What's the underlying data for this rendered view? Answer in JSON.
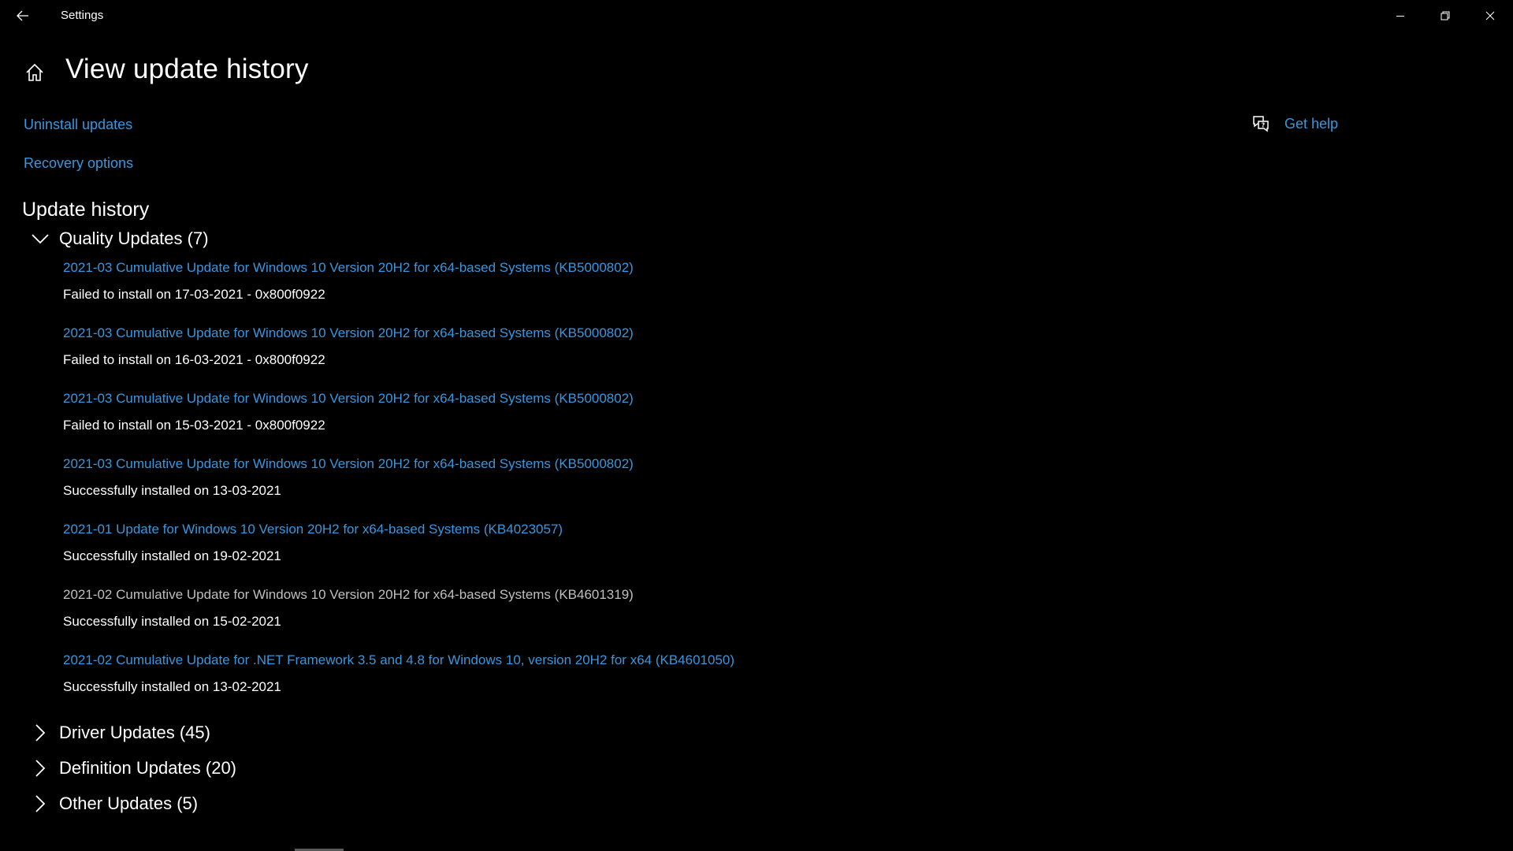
{
  "window": {
    "app_title": "Settings"
  },
  "header": {
    "page_title": "View update history"
  },
  "links": {
    "uninstall": "Uninstall updates",
    "recovery": "Recovery options",
    "get_help": "Get help"
  },
  "section_title": "Update history",
  "groups": {
    "quality": {
      "label": "Quality Updates (7)",
      "expanded": true
    },
    "driver": {
      "label": "Driver Updates (45)",
      "expanded": false
    },
    "definition": {
      "label": "Definition Updates (20)",
      "expanded": false
    },
    "other": {
      "label": "Other Updates (5)",
      "expanded": false
    }
  },
  "quality_updates": [
    {
      "title": "2021-03 Cumulative Update for Windows 10 Version 20H2 for x64-based Systems (KB5000802)",
      "status": "Failed to install on 17-03-2021 - 0x800f0922",
      "is_link": true
    },
    {
      "title": "2021-03 Cumulative Update for Windows 10 Version 20H2 for x64-based Systems (KB5000802)",
      "status": "Failed to install on 16-03-2021 - 0x800f0922",
      "is_link": true
    },
    {
      "title": "2021-03 Cumulative Update for Windows 10 Version 20H2 for x64-based Systems (KB5000802)",
      "status": "Failed to install on 15-03-2021 - 0x800f0922",
      "is_link": true
    },
    {
      "title": "2021-03 Cumulative Update for Windows 10 Version 20H2 for x64-based Systems (KB5000802)",
      "status": "Successfully installed on 13-03-2021",
      "is_link": true
    },
    {
      "title": "2021-01 Update for Windows 10 Version 20H2 for x64-based Systems (KB4023057)",
      "status": "Successfully installed on 19-02-2021",
      "is_link": true
    },
    {
      "title": "2021-02 Cumulative Update for Windows 10 Version 20H2 for x64-based Systems (KB4601319)",
      "status": "Successfully installed on 15-02-2021",
      "is_link": false
    },
    {
      "title": "2021-02 Cumulative Update for .NET Framework 3.5 and 4.8 for Windows 10, version 20H2 for x64 (KB4601050)",
      "status": "Successfully installed on 13-02-2021",
      "is_link": true
    }
  ],
  "icons": {
    "back": "back-arrow-icon",
    "home": "home-icon",
    "help": "chat-help-icon",
    "minimize": "minimize-icon",
    "maximize": "restore-icon",
    "close": "close-icon",
    "collapse": "chevron-down-icon",
    "expand": "chevron-right-icon"
  },
  "colors": {
    "background": "#000000",
    "accent_link": "#3a96dd",
    "text": "#ffffff",
    "muted_text": "#bfbfbf"
  }
}
